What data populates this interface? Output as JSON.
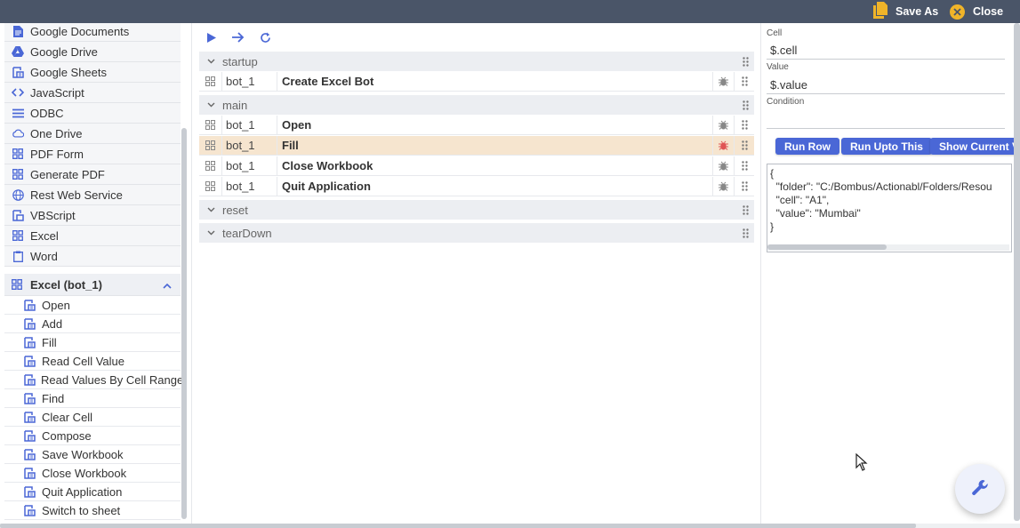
{
  "topbar": {
    "save_as_label": "Save As",
    "close_label": "Close"
  },
  "sidebar": {
    "items": [
      {
        "label": "Google Documents",
        "icon": "document-icon"
      },
      {
        "label": "Google Drive",
        "icon": "drive-icon"
      },
      {
        "label": "Google Sheets",
        "icon": "sheets-icon"
      },
      {
        "label": "JavaScript",
        "icon": "code-icon"
      },
      {
        "label": "ODBC",
        "icon": "list-icon"
      },
      {
        "label": "One Drive",
        "icon": "cloud-icon"
      },
      {
        "label": "PDF Form",
        "icon": "grid-icon"
      },
      {
        "label": "Generate PDF",
        "icon": "grid-icon"
      },
      {
        "label": "Rest Web Service",
        "icon": "globe-icon"
      },
      {
        "label": "VBScript",
        "icon": "script-icon"
      },
      {
        "label": "Excel",
        "icon": "grid-icon"
      },
      {
        "label": "Word",
        "icon": "clipboard-icon"
      }
    ],
    "group": {
      "label": "Excel (bot_1)",
      "actions": [
        "Open",
        "Add",
        "Fill",
        "Read Cell Value",
        "Read Values By Cell Range",
        "Find",
        "Clear Cell",
        "Compose",
        "Save Workbook",
        "Close Workbook",
        "Quit Application",
        "Switch to sheet"
      ]
    }
  },
  "flow": {
    "sections": {
      "startup": "startup",
      "main": "main",
      "reset": "reset",
      "teardown": "tearDown"
    },
    "startup_rows": [
      {
        "bot": "bot_1",
        "action": "Create Excel Bot"
      }
    ],
    "main_rows": [
      {
        "bot": "bot_1",
        "action": "Open"
      },
      {
        "bot": "bot_1",
        "action": "Fill"
      },
      {
        "bot": "bot_1",
        "action": "Close Workbook"
      },
      {
        "bot": "bot_1",
        "action": "Quit Application"
      }
    ],
    "selected_row": "Fill"
  },
  "properties": {
    "cell_label": "Cell",
    "cell_value": "$.cell",
    "value_label": "Value",
    "value_value": "$.value",
    "condition_label": "Condition",
    "condition_value": "",
    "run_row_label": "Run Row",
    "run_upto_label": "Run Upto This",
    "show_current_label": "Show Current Va",
    "json_text": "{\n  \"folder\": \"C:/Bombus/Actionabl/Folders/Resou\n  \"cell\": \"A1\",\n  \"value\": \"Mumbai\"\n}"
  },
  "colors": {
    "topbar": "#4a5568",
    "accent": "#4a67d6",
    "highlight_row": "#f6e5cf",
    "close_icon": "#f0b429",
    "debug_active": "#e05555"
  }
}
